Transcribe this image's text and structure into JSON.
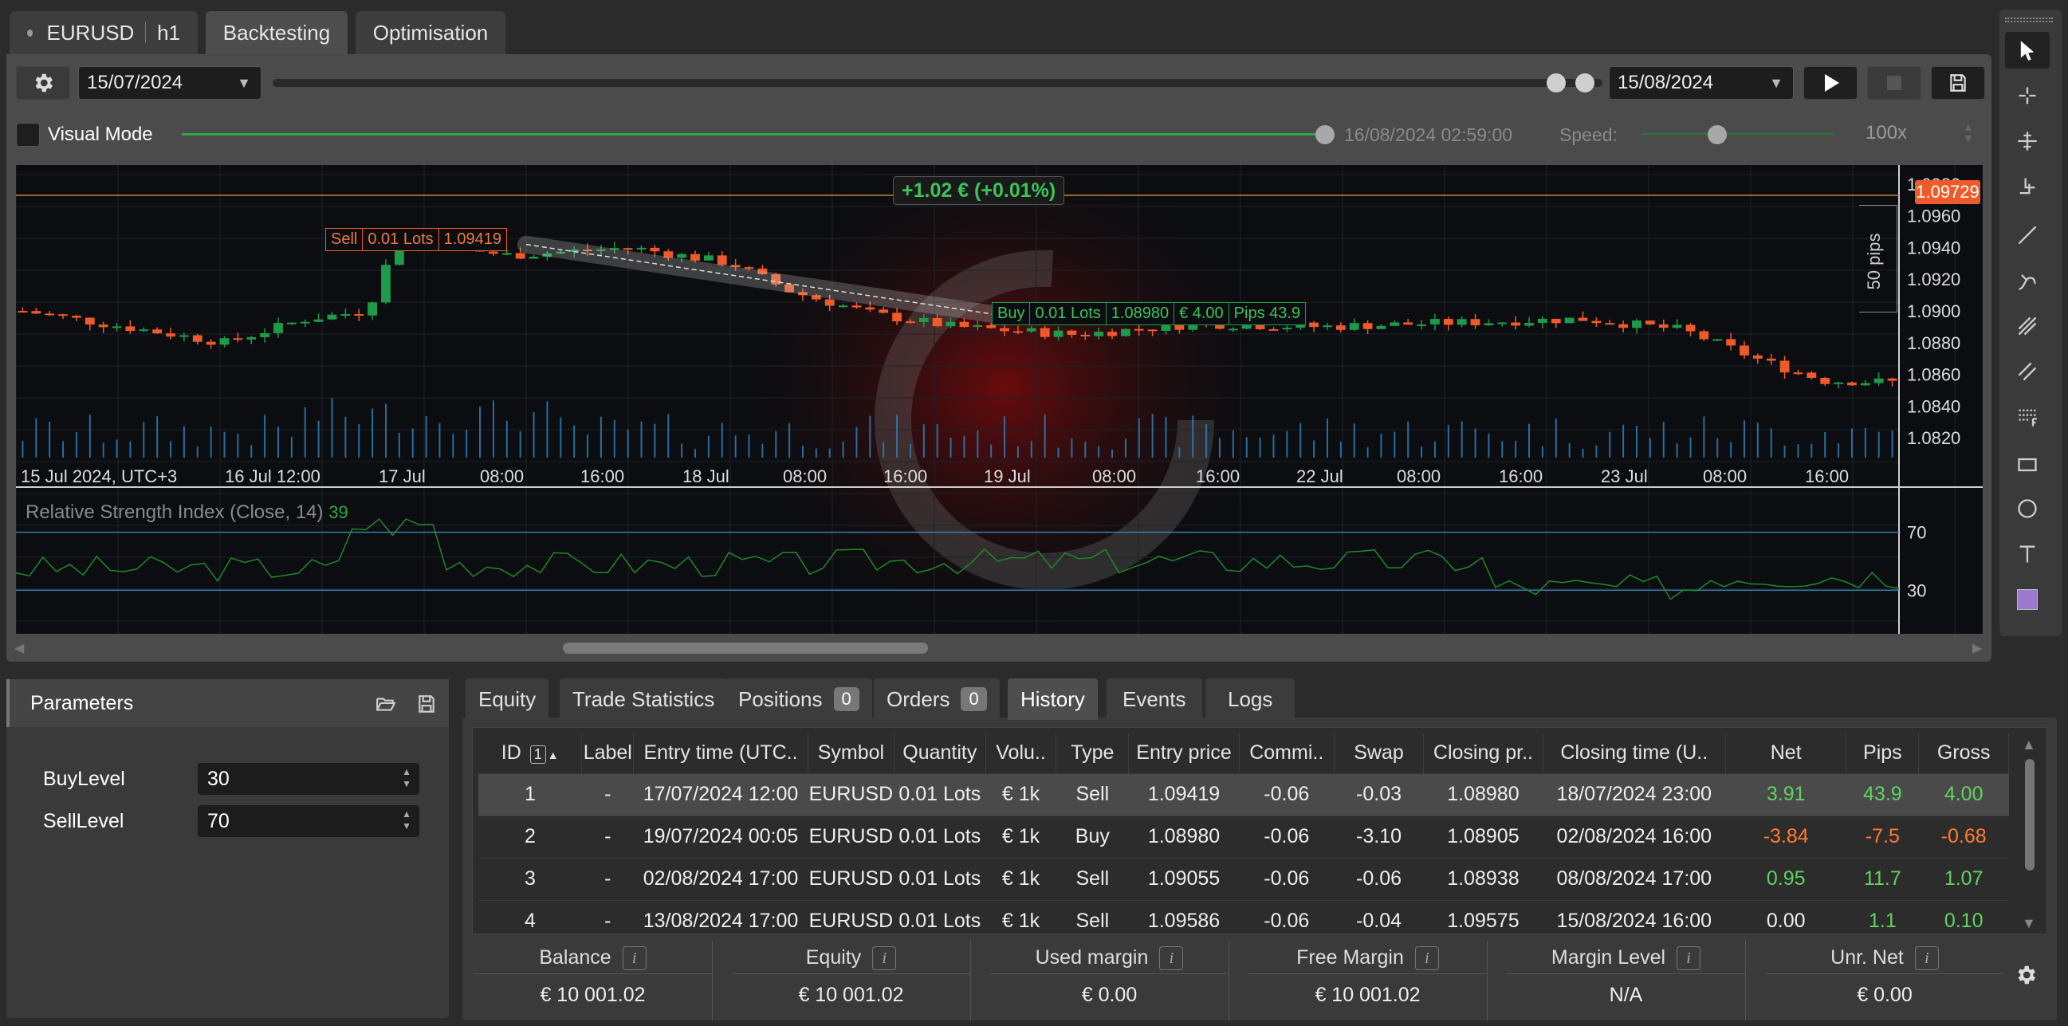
{
  "tabs": {
    "symbol": "EURUSD",
    "timeframe": "h1",
    "backtesting": "Backtesting",
    "optimisation": "Optimisation"
  },
  "toolbar": {
    "start_date": "15/07/2024",
    "end_date": "15/08/2024",
    "visual_mode": "Visual Mode",
    "current_time": "16/08/2024 02:59:00",
    "speed_label": "Speed:",
    "speed_value": "100x"
  },
  "chart": {
    "pnl_label": "+1.02 € (+0.01%)",
    "current_price": "1.09729",
    "pips_label": "50 pips",
    "price_axis": [
      "1.0980",
      "1.0960",
      "1.0940",
      "1.0920",
      "1.0900",
      "1.0880",
      "1.0860",
      "1.0840",
      "1.0820"
    ],
    "time_axis": [
      "15 Jul 2024, UTC+3",
      "16 Jul 12:00",
      "17 Jul",
      "08:00",
      "16:00",
      "18 Jul",
      "08:00",
      "16:00",
      "19 Jul",
      "08:00",
      "16:00",
      "22 Jul",
      "08:00",
      "16:00",
      "23 Jul",
      "08:00",
      "16:00"
    ],
    "sell_tag": {
      "side": "Sell",
      "lots": "0.01 Lots",
      "price": "1.09419"
    },
    "buy_tag": {
      "side": "Buy",
      "lots": "0.01 Lots",
      "price": "1.08980",
      "pnl": "€ 4.00",
      "pips": "Pips 43.9"
    },
    "rsi_title": "Relative Strength Index (Close, 14)",
    "rsi_value": "39",
    "rsi_levels": [
      "70",
      "30"
    ],
    "colors": {
      "bull": "#1e9b4a",
      "bear": "#ef5a2a",
      "volume": "#2f7fb8",
      "rsi": "#1f8a2a",
      "level": "#3a7fb0",
      "price_tag": "#ef5a2a"
    }
  },
  "params": {
    "title": "Parameters",
    "items": [
      {
        "label": "BuyLevel",
        "value": "30"
      },
      {
        "label": "SellLevel",
        "value": "70"
      }
    ]
  },
  "bottom_tabs": {
    "equity": "Equity",
    "trade_stats": "Trade Statistics",
    "positions": "Positions",
    "positions_count": "0",
    "orders": "Orders",
    "orders_count": "0",
    "history": "History",
    "events": "Events",
    "logs": "Logs"
  },
  "history": {
    "sort_badge": "1",
    "columns": [
      "ID",
      "Label",
      "Entry time (UTC..",
      "Symbol",
      "Quantity",
      "Volu..",
      "Type",
      "Entry price",
      "Commi..",
      "Swap",
      "Closing pr..",
      "Closing time (U..",
      "Net",
      "Pips",
      "Gross"
    ],
    "rows": [
      [
        "1",
        "-",
        "17/07/2024 12:00",
        "EURUSD",
        "0.01 Lots",
        "€ 1k",
        "Sell",
        "1.09419",
        "-0.06",
        "-0.03",
        "1.08980",
        "18/07/2024 23:00",
        "3.91",
        "43.9",
        "4.00"
      ],
      [
        "2",
        "-",
        "19/07/2024 00:05",
        "EURUSD",
        "0.01 Lots",
        "€ 1k",
        "Buy",
        "1.08980",
        "-0.06",
        "-3.10",
        "1.08905",
        "02/08/2024 16:00",
        "-3.84",
        "-7.5",
        "-0.68"
      ],
      [
        "3",
        "-",
        "02/08/2024 17:00",
        "EURUSD",
        "0.01 Lots",
        "€ 1k",
        "Sell",
        "1.09055",
        "-0.06",
        "-0.06",
        "1.08938",
        "08/08/2024 17:00",
        "0.95",
        "11.7",
        "1.07"
      ],
      [
        "4",
        "-",
        "13/08/2024 17:00",
        "EURUSD",
        "0.01 Lots",
        "€ 1k",
        "Sell",
        "1.09586",
        "-0.06",
        "-0.04",
        "1.09575",
        "15/08/2024 16:00",
        "0.00",
        "1.1",
        "0.10"
      ]
    ]
  },
  "summary": [
    {
      "label": "Balance",
      "value": "€ 10 001.02"
    },
    {
      "label": "Equity",
      "value": "€ 10 001.02"
    },
    {
      "label": "Used margin",
      "value": "€ 0.00"
    },
    {
      "label": "Free Margin",
      "value": "€ 10 001.02"
    },
    {
      "label": "Margin Level",
      "value": "N/A"
    },
    {
      "label": "Unr. Net",
      "value": "€ 0.00"
    }
  ]
}
